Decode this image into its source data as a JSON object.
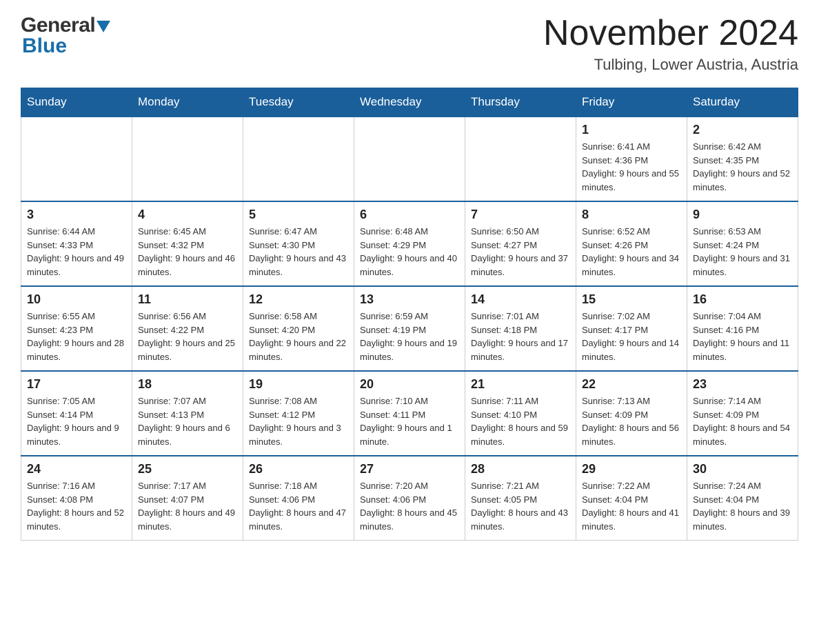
{
  "header": {
    "logo_general": "General",
    "logo_blue": "Blue",
    "month_title": "November 2024",
    "location": "Tulbing, Lower Austria, Austria"
  },
  "days_of_week": [
    "Sunday",
    "Monday",
    "Tuesday",
    "Wednesday",
    "Thursday",
    "Friday",
    "Saturday"
  ],
  "weeks": [
    {
      "days": [
        {
          "number": "",
          "info": ""
        },
        {
          "number": "",
          "info": ""
        },
        {
          "number": "",
          "info": ""
        },
        {
          "number": "",
          "info": ""
        },
        {
          "number": "",
          "info": ""
        },
        {
          "number": "1",
          "info": "Sunrise: 6:41 AM\nSunset: 4:36 PM\nDaylight: 9 hours and 55 minutes."
        },
        {
          "number": "2",
          "info": "Sunrise: 6:42 AM\nSunset: 4:35 PM\nDaylight: 9 hours and 52 minutes."
        }
      ]
    },
    {
      "days": [
        {
          "number": "3",
          "info": "Sunrise: 6:44 AM\nSunset: 4:33 PM\nDaylight: 9 hours and 49 minutes."
        },
        {
          "number": "4",
          "info": "Sunrise: 6:45 AM\nSunset: 4:32 PM\nDaylight: 9 hours and 46 minutes."
        },
        {
          "number": "5",
          "info": "Sunrise: 6:47 AM\nSunset: 4:30 PM\nDaylight: 9 hours and 43 minutes."
        },
        {
          "number": "6",
          "info": "Sunrise: 6:48 AM\nSunset: 4:29 PM\nDaylight: 9 hours and 40 minutes."
        },
        {
          "number": "7",
          "info": "Sunrise: 6:50 AM\nSunset: 4:27 PM\nDaylight: 9 hours and 37 minutes."
        },
        {
          "number": "8",
          "info": "Sunrise: 6:52 AM\nSunset: 4:26 PM\nDaylight: 9 hours and 34 minutes."
        },
        {
          "number": "9",
          "info": "Sunrise: 6:53 AM\nSunset: 4:24 PM\nDaylight: 9 hours and 31 minutes."
        }
      ]
    },
    {
      "days": [
        {
          "number": "10",
          "info": "Sunrise: 6:55 AM\nSunset: 4:23 PM\nDaylight: 9 hours and 28 minutes."
        },
        {
          "number": "11",
          "info": "Sunrise: 6:56 AM\nSunset: 4:22 PM\nDaylight: 9 hours and 25 minutes."
        },
        {
          "number": "12",
          "info": "Sunrise: 6:58 AM\nSunset: 4:20 PM\nDaylight: 9 hours and 22 minutes."
        },
        {
          "number": "13",
          "info": "Sunrise: 6:59 AM\nSunset: 4:19 PM\nDaylight: 9 hours and 19 minutes."
        },
        {
          "number": "14",
          "info": "Sunrise: 7:01 AM\nSunset: 4:18 PM\nDaylight: 9 hours and 17 minutes."
        },
        {
          "number": "15",
          "info": "Sunrise: 7:02 AM\nSunset: 4:17 PM\nDaylight: 9 hours and 14 minutes."
        },
        {
          "number": "16",
          "info": "Sunrise: 7:04 AM\nSunset: 4:16 PM\nDaylight: 9 hours and 11 minutes."
        }
      ]
    },
    {
      "days": [
        {
          "number": "17",
          "info": "Sunrise: 7:05 AM\nSunset: 4:14 PM\nDaylight: 9 hours and 9 minutes."
        },
        {
          "number": "18",
          "info": "Sunrise: 7:07 AM\nSunset: 4:13 PM\nDaylight: 9 hours and 6 minutes."
        },
        {
          "number": "19",
          "info": "Sunrise: 7:08 AM\nSunset: 4:12 PM\nDaylight: 9 hours and 3 minutes."
        },
        {
          "number": "20",
          "info": "Sunrise: 7:10 AM\nSunset: 4:11 PM\nDaylight: 9 hours and 1 minute."
        },
        {
          "number": "21",
          "info": "Sunrise: 7:11 AM\nSunset: 4:10 PM\nDaylight: 8 hours and 59 minutes."
        },
        {
          "number": "22",
          "info": "Sunrise: 7:13 AM\nSunset: 4:09 PM\nDaylight: 8 hours and 56 minutes."
        },
        {
          "number": "23",
          "info": "Sunrise: 7:14 AM\nSunset: 4:09 PM\nDaylight: 8 hours and 54 minutes."
        }
      ]
    },
    {
      "days": [
        {
          "number": "24",
          "info": "Sunrise: 7:16 AM\nSunset: 4:08 PM\nDaylight: 8 hours and 52 minutes."
        },
        {
          "number": "25",
          "info": "Sunrise: 7:17 AM\nSunset: 4:07 PM\nDaylight: 8 hours and 49 minutes."
        },
        {
          "number": "26",
          "info": "Sunrise: 7:18 AM\nSunset: 4:06 PM\nDaylight: 8 hours and 47 minutes."
        },
        {
          "number": "27",
          "info": "Sunrise: 7:20 AM\nSunset: 4:06 PM\nDaylight: 8 hours and 45 minutes."
        },
        {
          "number": "28",
          "info": "Sunrise: 7:21 AM\nSunset: 4:05 PM\nDaylight: 8 hours and 43 minutes."
        },
        {
          "number": "29",
          "info": "Sunrise: 7:22 AM\nSunset: 4:04 PM\nDaylight: 8 hours and 41 minutes."
        },
        {
          "number": "30",
          "info": "Sunrise: 7:24 AM\nSunset: 4:04 PM\nDaylight: 8 hours and 39 minutes."
        }
      ]
    }
  ]
}
